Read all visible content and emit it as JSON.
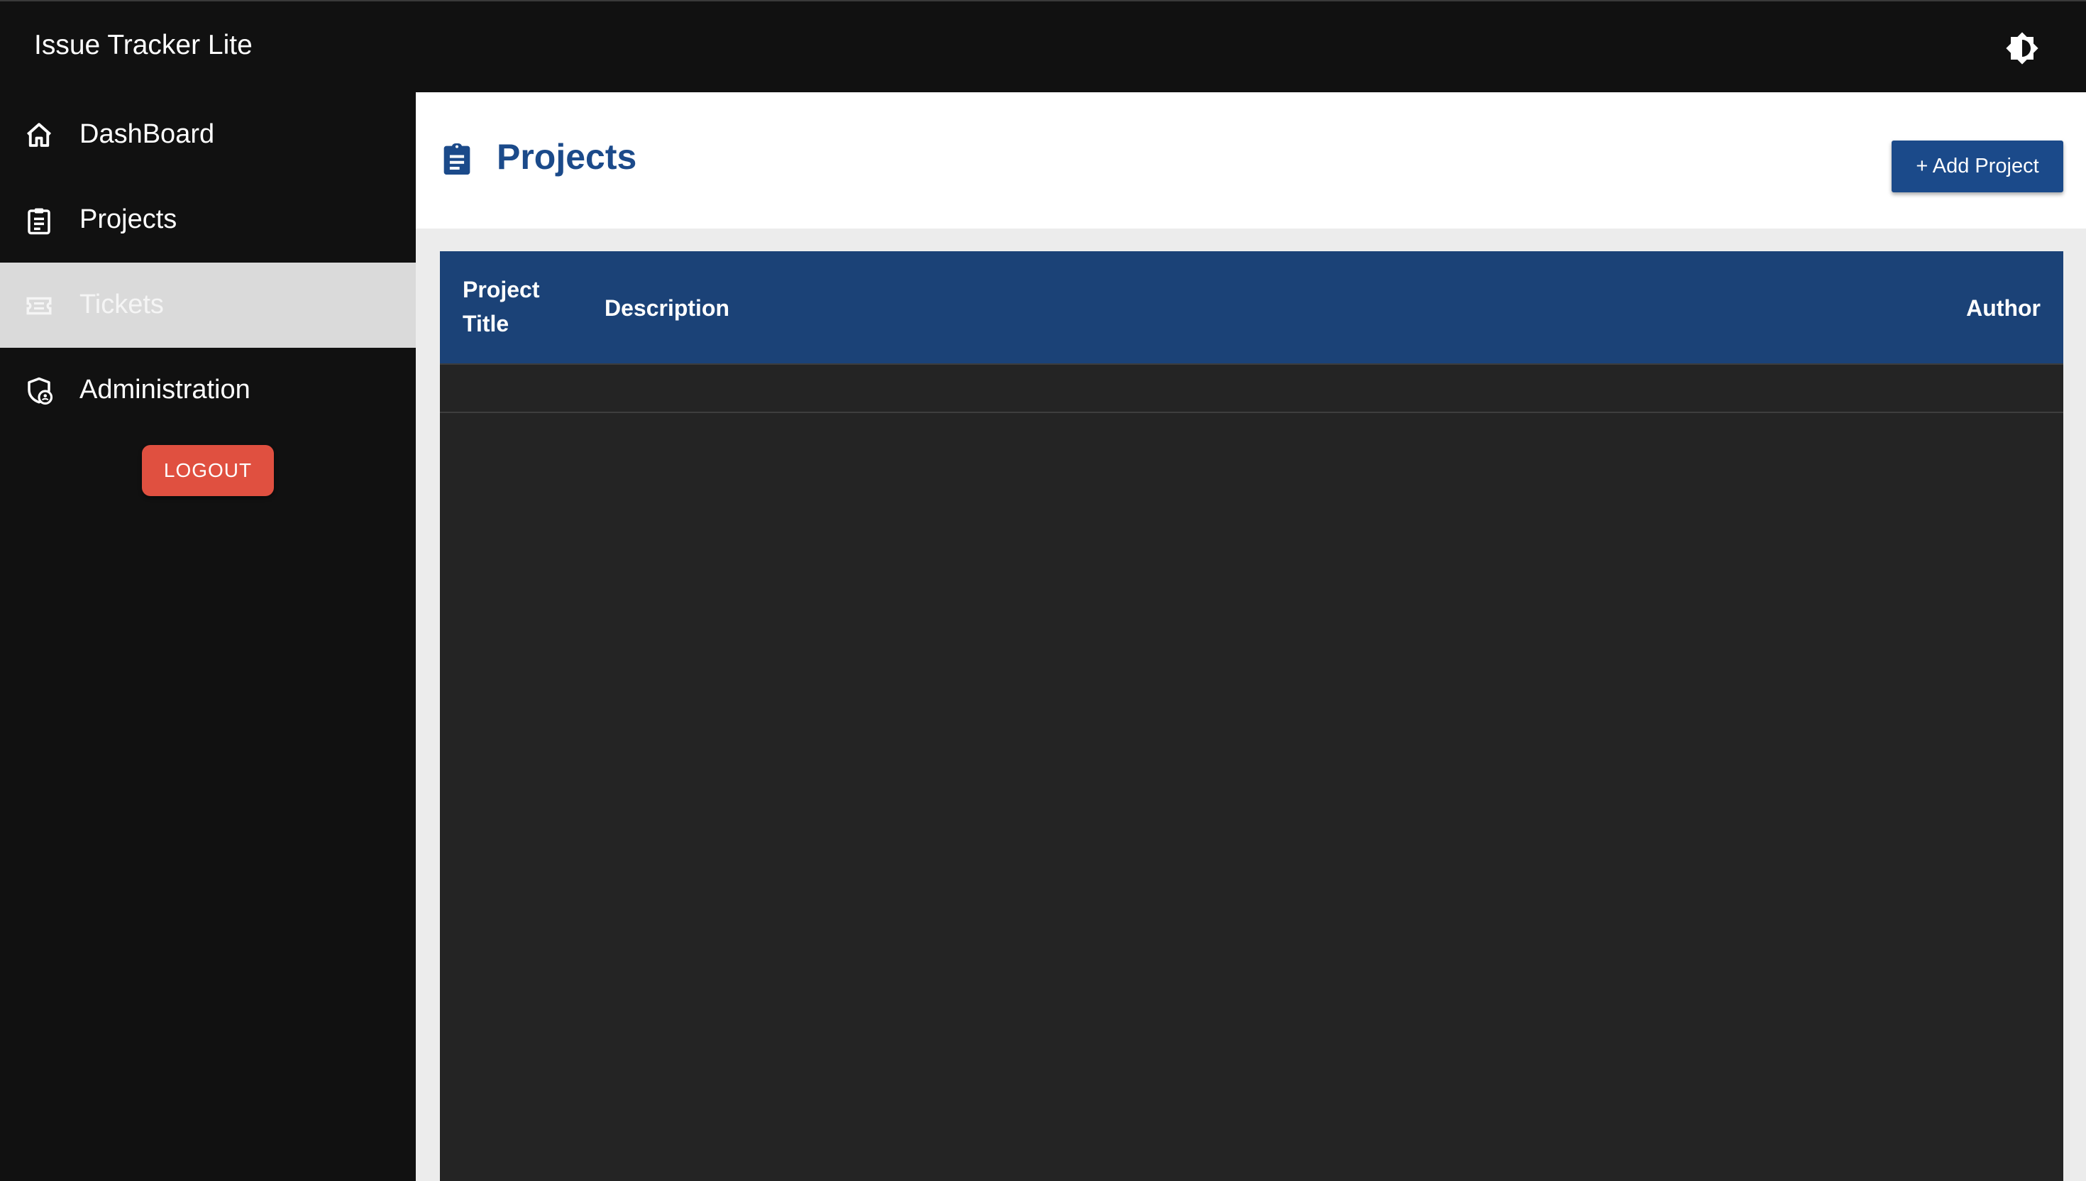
{
  "app": {
    "title": "Issue Tracker Lite",
    "theme_toggle_icon": "brightness-icon"
  },
  "sidebar": {
    "items": [
      {
        "label": "DashBoard",
        "icon": "home-icon",
        "active": false
      },
      {
        "label": "Projects",
        "icon": "clipboard-icon",
        "active": false
      },
      {
        "label": "Tickets",
        "icon": "ticket-icon",
        "active": true
      },
      {
        "label": "Administration",
        "icon": "shield-user-icon",
        "active": false
      }
    ],
    "logout_label": "LOGOUT"
  },
  "page": {
    "title": "Projects",
    "icon": "clipboard-icon",
    "add_button_label": "+ Add Project"
  },
  "table": {
    "columns": [
      "Project Title",
      "Description",
      "Author"
    ],
    "rows": []
  },
  "colors": {
    "primary": "#1b4a8a",
    "table_header": "#1b4277",
    "logout": "#e05040",
    "sidebar_bg": "#111111",
    "active_item_bg": "#dadada"
  }
}
